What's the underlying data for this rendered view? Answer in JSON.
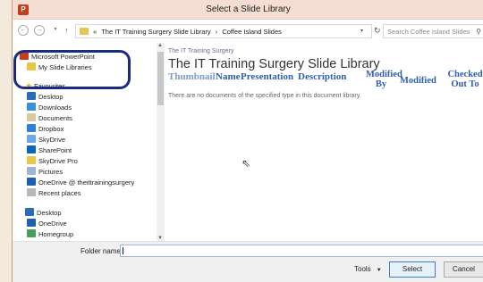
{
  "dialog": {
    "title": "Select a Slide Library"
  },
  "address": {
    "crumbs": [
      "«",
      "The IT Training Surgery Slide Library",
      "›",
      "Coffee Island Slides"
    ],
    "search_placeholder": "Search Coffee Island Slides"
  },
  "nav": {
    "items": [
      {
        "label": "Microsoft PowerPoint",
        "icon": "powerpoint-icon"
      },
      {
        "label": "My Slide Libraries",
        "icon": "folder-icon"
      },
      {
        "label": "Favourites",
        "icon": "star-icon"
      },
      {
        "label": "Desktop",
        "icon": "desktop-icon"
      },
      {
        "label": "Downloads",
        "icon": "downloads-icon"
      },
      {
        "label": "Documents",
        "icon": "documents-icon"
      },
      {
        "label": "Dropbox",
        "icon": "dropbox-icon"
      },
      {
        "label": "SkyDrive",
        "icon": "skydrive-icon"
      },
      {
        "label": "SharePoint",
        "icon": "sharepoint-icon"
      },
      {
        "label": "SkyDrive Pro",
        "icon": "skydrive-pro-icon"
      },
      {
        "label": "Pictures",
        "icon": "pictures-icon"
      },
      {
        "label": "OneDrive @ theittrainingsurgery",
        "icon": "onedrive-icon"
      },
      {
        "label": "Recent places",
        "icon": "recent-places-icon"
      },
      {
        "label": "Desktop",
        "icon": "desktop-icon"
      },
      {
        "label": "OneDrive",
        "icon": "onedrive-icon"
      },
      {
        "label": "Homegroup",
        "icon": "homegroup-icon"
      }
    ]
  },
  "content": {
    "site_name": "The IT Training Surgery",
    "library_title": "The IT Training Surgery Slide Library",
    "columns": {
      "thumbnail": "Thumbnail",
      "name": "Name",
      "presentation": "Presentation",
      "description": "Description",
      "modified_by": "Modified By",
      "modified": "Modified",
      "checked_out_to": "Checked Out To"
    },
    "empty_message": "There are no documents of the specified type in this document library."
  },
  "footer": {
    "folder_name_label": "Folder name:",
    "folder_name_value": "",
    "tools_label": "Tools",
    "select_label": "Select",
    "cancel_label": "Cancel"
  },
  "colors": {
    "highlight_ring": "#1c2a84",
    "column_header": "#2f5fb3",
    "titlebar": "#f5ddd3"
  }
}
